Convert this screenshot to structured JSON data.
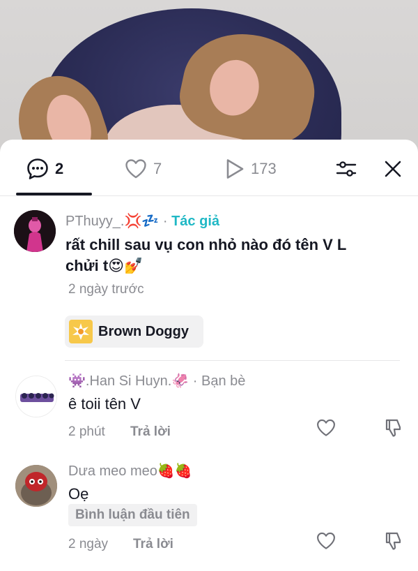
{
  "tabs": {
    "comments_count": "2",
    "likes_count": "7",
    "plays_count": "173"
  },
  "comments": [
    {
      "username": "PThuyy_.💢💤",
      "separator": "·",
      "role": "Tác giả",
      "text_line1": "rất chill sau vụ con nhỏ nào đó tên V   L",
      "text_line2": "chửi t😍💅",
      "time": "2 ngày trước",
      "sticker_label": "Brown Doggy"
    },
    {
      "username": "👾.Han Si Huyn.🦑",
      "separator": "·",
      "role": "Bạn bè",
      "text": "ê toii tên V",
      "time": "2 phút",
      "reply_label": "Trả lời"
    },
    {
      "username": "Dưa meo meo🍓🍓",
      "text": "Oẹ",
      "badge": "Bình luận đầu tiên",
      "time": "2 ngày",
      "reply_label": "Trả lời"
    }
  ],
  "colors": {
    "author_accent": "#20b8c5",
    "secondary_text": "#8a8b91",
    "primary_text": "#161823"
  }
}
